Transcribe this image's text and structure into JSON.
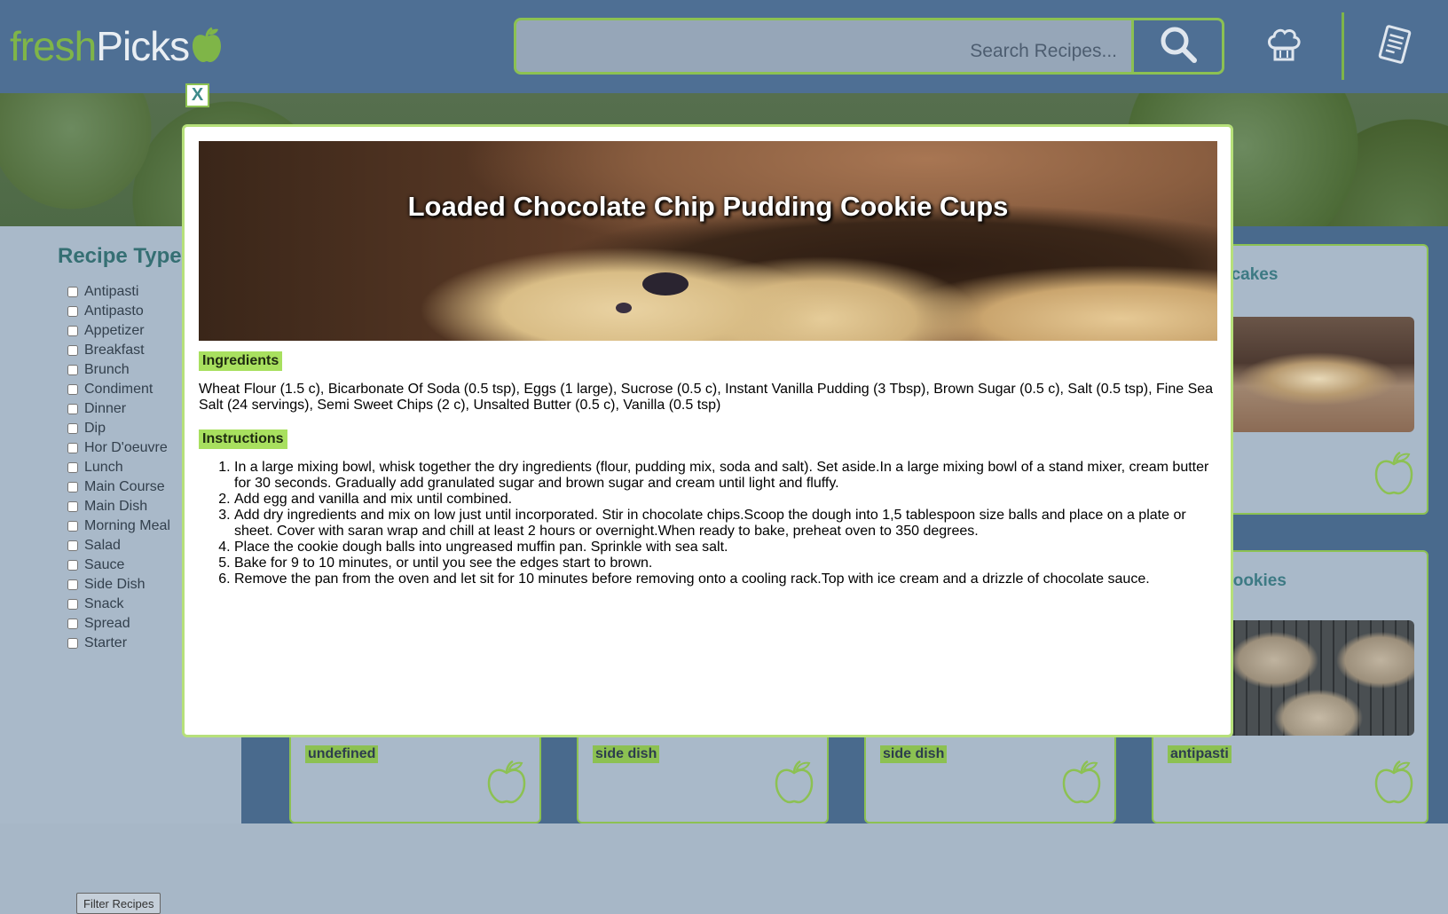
{
  "brand": {
    "part1": "fresh",
    "part2": "Picks"
  },
  "search": {
    "placeholder": "Search Recipes..."
  },
  "header_icons": [
    "search-icon",
    "chef-hat-icon",
    "recipe-list-icon"
  ],
  "colors": {
    "accent": "#8cc152",
    "header": "#4e6f94",
    "modal_border": "#b6e07a",
    "label_bg": "#a8e05f"
  },
  "sidebar": {
    "title": "Recipe Type",
    "types": [
      "Antipasti",
      "Antipasto",
      "Appetizer",
      "Breakfast",
      "Brunch",
      "Condiment",
      "Dinner",
      "Dip",
      "Hor D'oeuvre",
      "Lunch",
      "Main Course",
      "Main Dish",
      "Morning Meal",
      "Salad",
      "Sauce",
      "Side Dish",
      "Snack",
      "Spread",
      "Starter"
    ],
    "filter_button": "Filter Recipes"
  },
  "background_cards": {
    "titles": [
      "ncakes",
      "Cookies"
    ],
    "tags": [
      "undefined",
      "side dish",
      "side dish",
      "antipasti"
    ]
  },
  "modal": {
    "close_label": "X",
    "title": "Loaded Chocolate Chip Pudding Cookie Cups",
    "ingredients_label": "Ingredients",
    "ingredients": "Wheat Flour (1.5 c), Bicarbonate Of Soda (0.5 tsp), Eggs (1 large), Sucrose (0.5 c), Instant Vanilla Pudding (3 Tbsp), Brown Sugar (0.5 c), Salt (0.5 tsp), Fine Sea Salt (24 servings), Semi Sweet Chips (2 c), Unsalted Butter (0.5 c), Vanilla (0.5 tsp)",
    "instructions_label": "Instructions",
    "instructions": [
      "In a large mixing bowl, whisk together the dry ingredients (flour, pudding mix, soda and salt). Set aside.In a large mixing bowl of a stand mixer, cream butter for 30 seconds. Gradually add granulated sugar and brown sugar and cream until light and fluffy.",
      "Add egg and vanilla and mix until combined.",
      "Add dry ingredients and mix on low just until incorporated. Stir in chocolate chips.Scoop the dough into 1,5 tablespoon size balls and place on a plate or sheet. Cover with saran wrap and chill at least 2 hours or overnight.When ready to bake, preheat oven to 350 degrees.",
      "Place the cookie dough balls into ungreased muffin pan. Sprinkle with sea salt.",
      "Bake for 9 to 10 minutes, or until you see the edges start to brown.",
      "Remove the pan from the oven and let sit for 10 minutes before removing onto a cooling rack.Top with ice cream and a drizzle of chocolate sauce."
    ]
  }
}
